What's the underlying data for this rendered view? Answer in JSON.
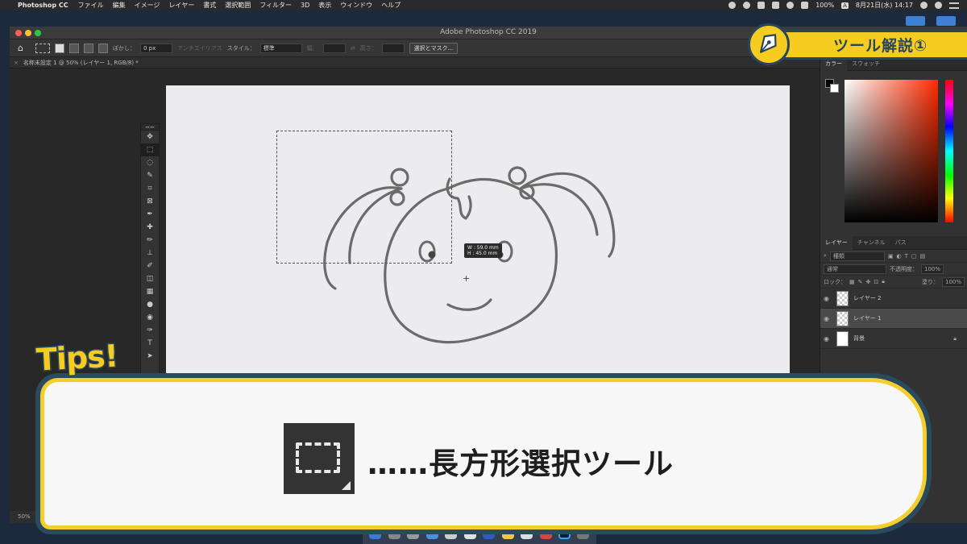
{
  "menubar": {
    "app_name": "Photoshop CC",
    "items": [
      "ファイル",
      "編集",
      "イメージ",
      "レイヤー",
      "書式",
      "選択範囲",
      "フィルター",
      "3D",
      "表示",
      "ウィンドウ",
      "ヘルプ"
    ],
    "battery": "100%",
    "input_mode": "A",
    "datetime": "8月21日(水) 14:17"
  },
  "window": {
    "title": "Adobe Photoshop CC 2019"
  },
  "options_bar": {
    "feather_label": "ぼかし：",
    "feather_value": "0 px",
    "antialias_label": "アンチエイリアス",
    "style_label": "スタイル：",
    "style_value": "標準",
    "width_label": "幅：",
    "height_label": "高さ：",
    "select_mask_button": "選択とマスク..."
  },
  "document_tab": {
    "title": "名称未設定 1 @ 50% (レイヤー 1, RGB/8) *"
  },
  "canvas": {
    "dimension_tooltip": [
      "W : 59.0 mm",
      "H : 45.0 mm"
    ]
  },
  "tools": {
    "icons": [
      "move-icon",
      "marquee-icon",
      "lasso-icon",
      "quick-select-icon",
      "crop-icon",
      "frame-icon",
      "eyedropper-icon",
      "healing-icon",
      "brush-icon",
      "stamp-icon",
      "history-brush-icon",
      "eraser-icon",
      "gradient-icon",
      "blur-icon",
      "dodge-icon",
      "pen-icon",
      "type-icon",
      "path-select-icon"
    ],
    "glyphs": [
      "✥",
      "⬚",
      "◌",
      "✎",
      "⌗",
      "⊠",
      "✒",
      "✚",
      "✏",
      "⊥",
      "✐",
      "◫",
      "▦",
      "●",
      "◉",
      "✑",
      "T",
      "➤"
    ],
    "active_index": 1
  },
  "color_panel": {
    "tabs": [
      "カラー",
      "スウォッチ"
    ],
    "fg_color": "#000000",
    "bg_color": "#ffffff"
  },
  "layers_panel": {
    "tabs": [
      "レイヤー",
      "チャンネル",
      "パス"
    ],
    "filter_label": "種類",
    "blend_mode": "通常",
    "opacity_label": "不透明度：",
    "opacity_value": "100%",
    "lock_label": "ロック：",
    "fill_label": "塗り：",
    "fill_value": "100%",
    "layers": [
      {
        "name": "レイヤー 2",
        "selected": false
      },
      {
        "name": "レイヤー 1",
        "selected": true
      },
      {
        "name": "背景",
        "selected": false,
        "locked": true
      }
    ]
  },
  "status_bar": {
    "zoom": "50%"
  },
  "overlay": {
    "badge_title": "ツール解説①",
    "tips_label": "Tips!",
    "tip_text": "……長方形選択ツール",
    "accent_yellow": "#f5cc1f",
    "accent_navy": "#29475b"
  }
}
